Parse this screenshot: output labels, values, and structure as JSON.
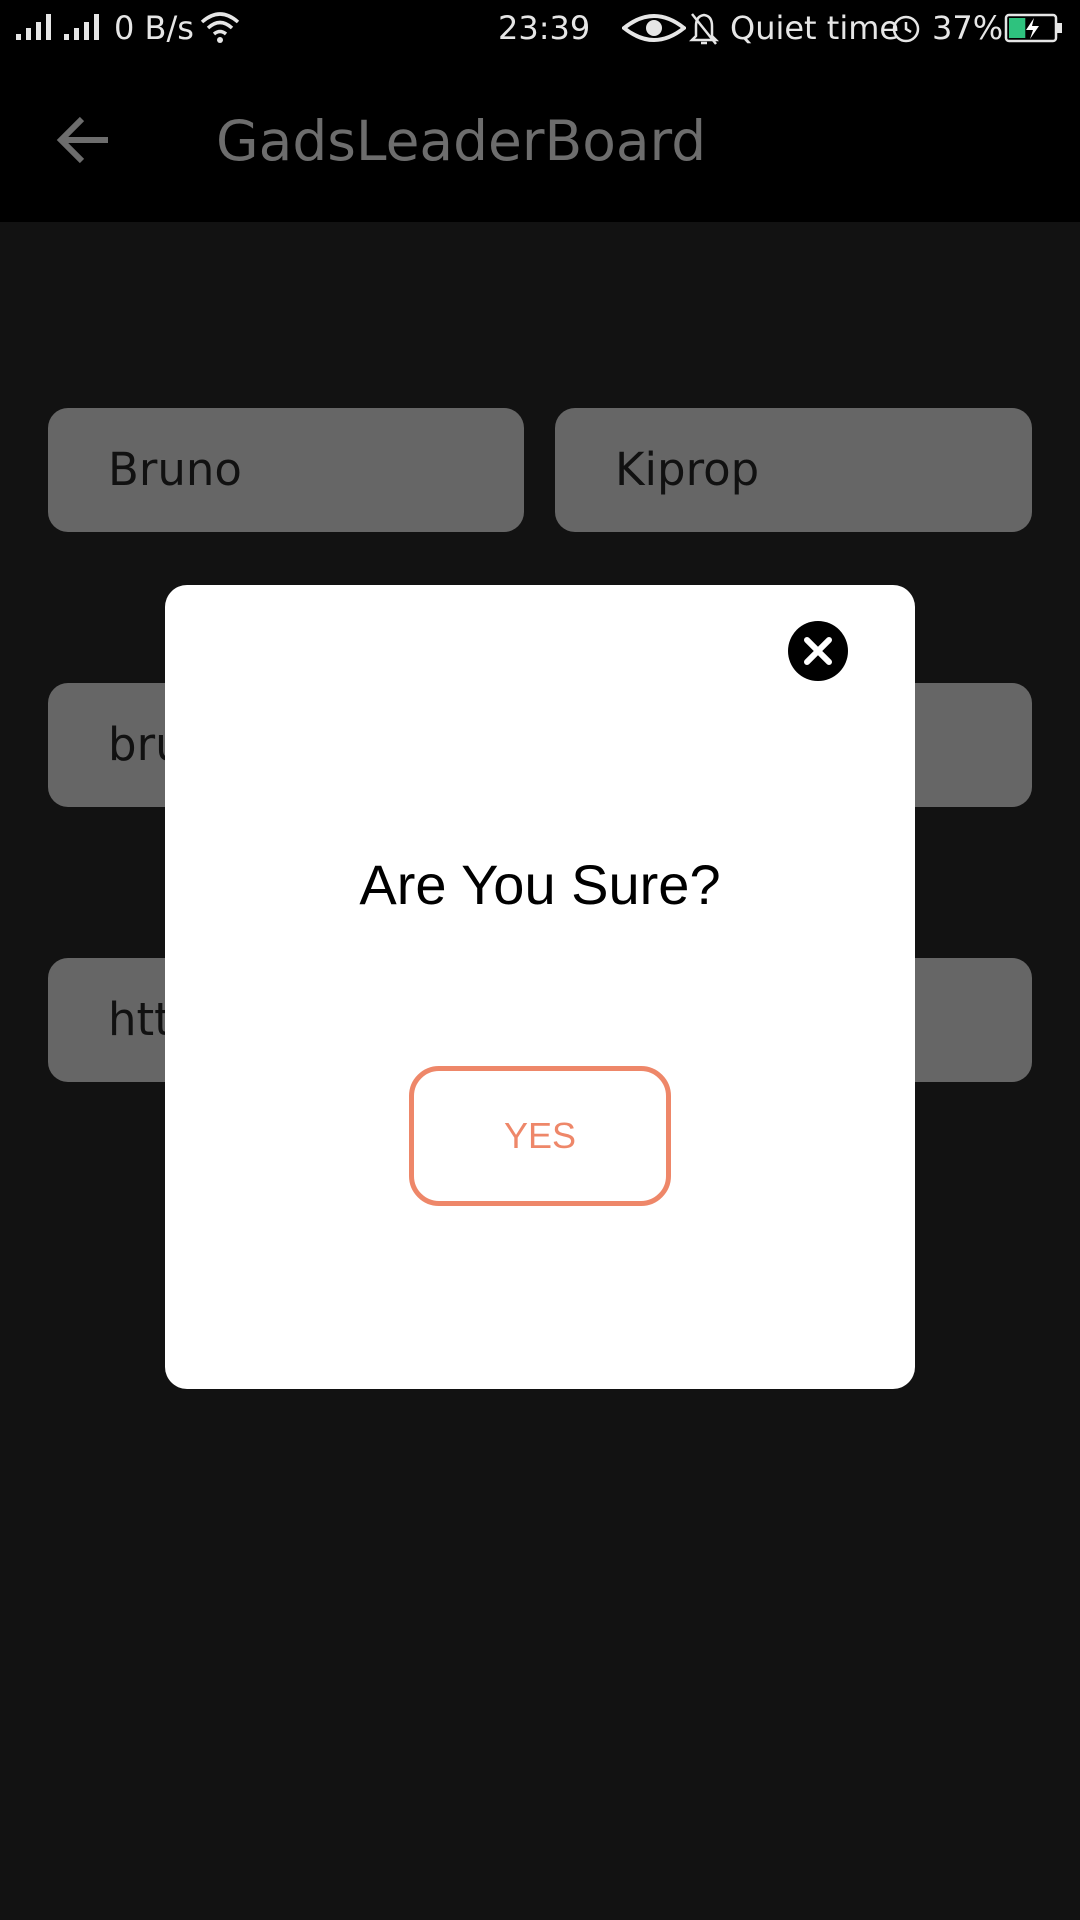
{
  "status_bar": {
    "network_speed": "0 B/s",
    "time": "23:39",
    "quiet_time_label": "Quiet time",
    "battery_percent": "37%",
    "battery_level": 0.37,
    "icons": [
      "signal-icon",
      "wifi-icon",
      "eye-icon",
      "bell-off-icon",
      "alarm-icon",
      "battery-charging-icon"
    ]
  },
  "toolbar": {
    "title": "GadsLeaderBoard",
    "back_icon": "arrow-left-icon"
  },
  "form": {
    "first_name": "Bruno",
    "last_name": "Kiprop",
    "email_partial": "bru",
    "link_partial": "htt"
  },
  "dialog": {
    "title": "Are You Sure?",
    "confirm_label": "YES",
    "close_icon": "close-icon"
  },
  "colors": {
    "accent": "#EE8769",
    "background": "#121212",
    "field": "#666666"
  }
}
